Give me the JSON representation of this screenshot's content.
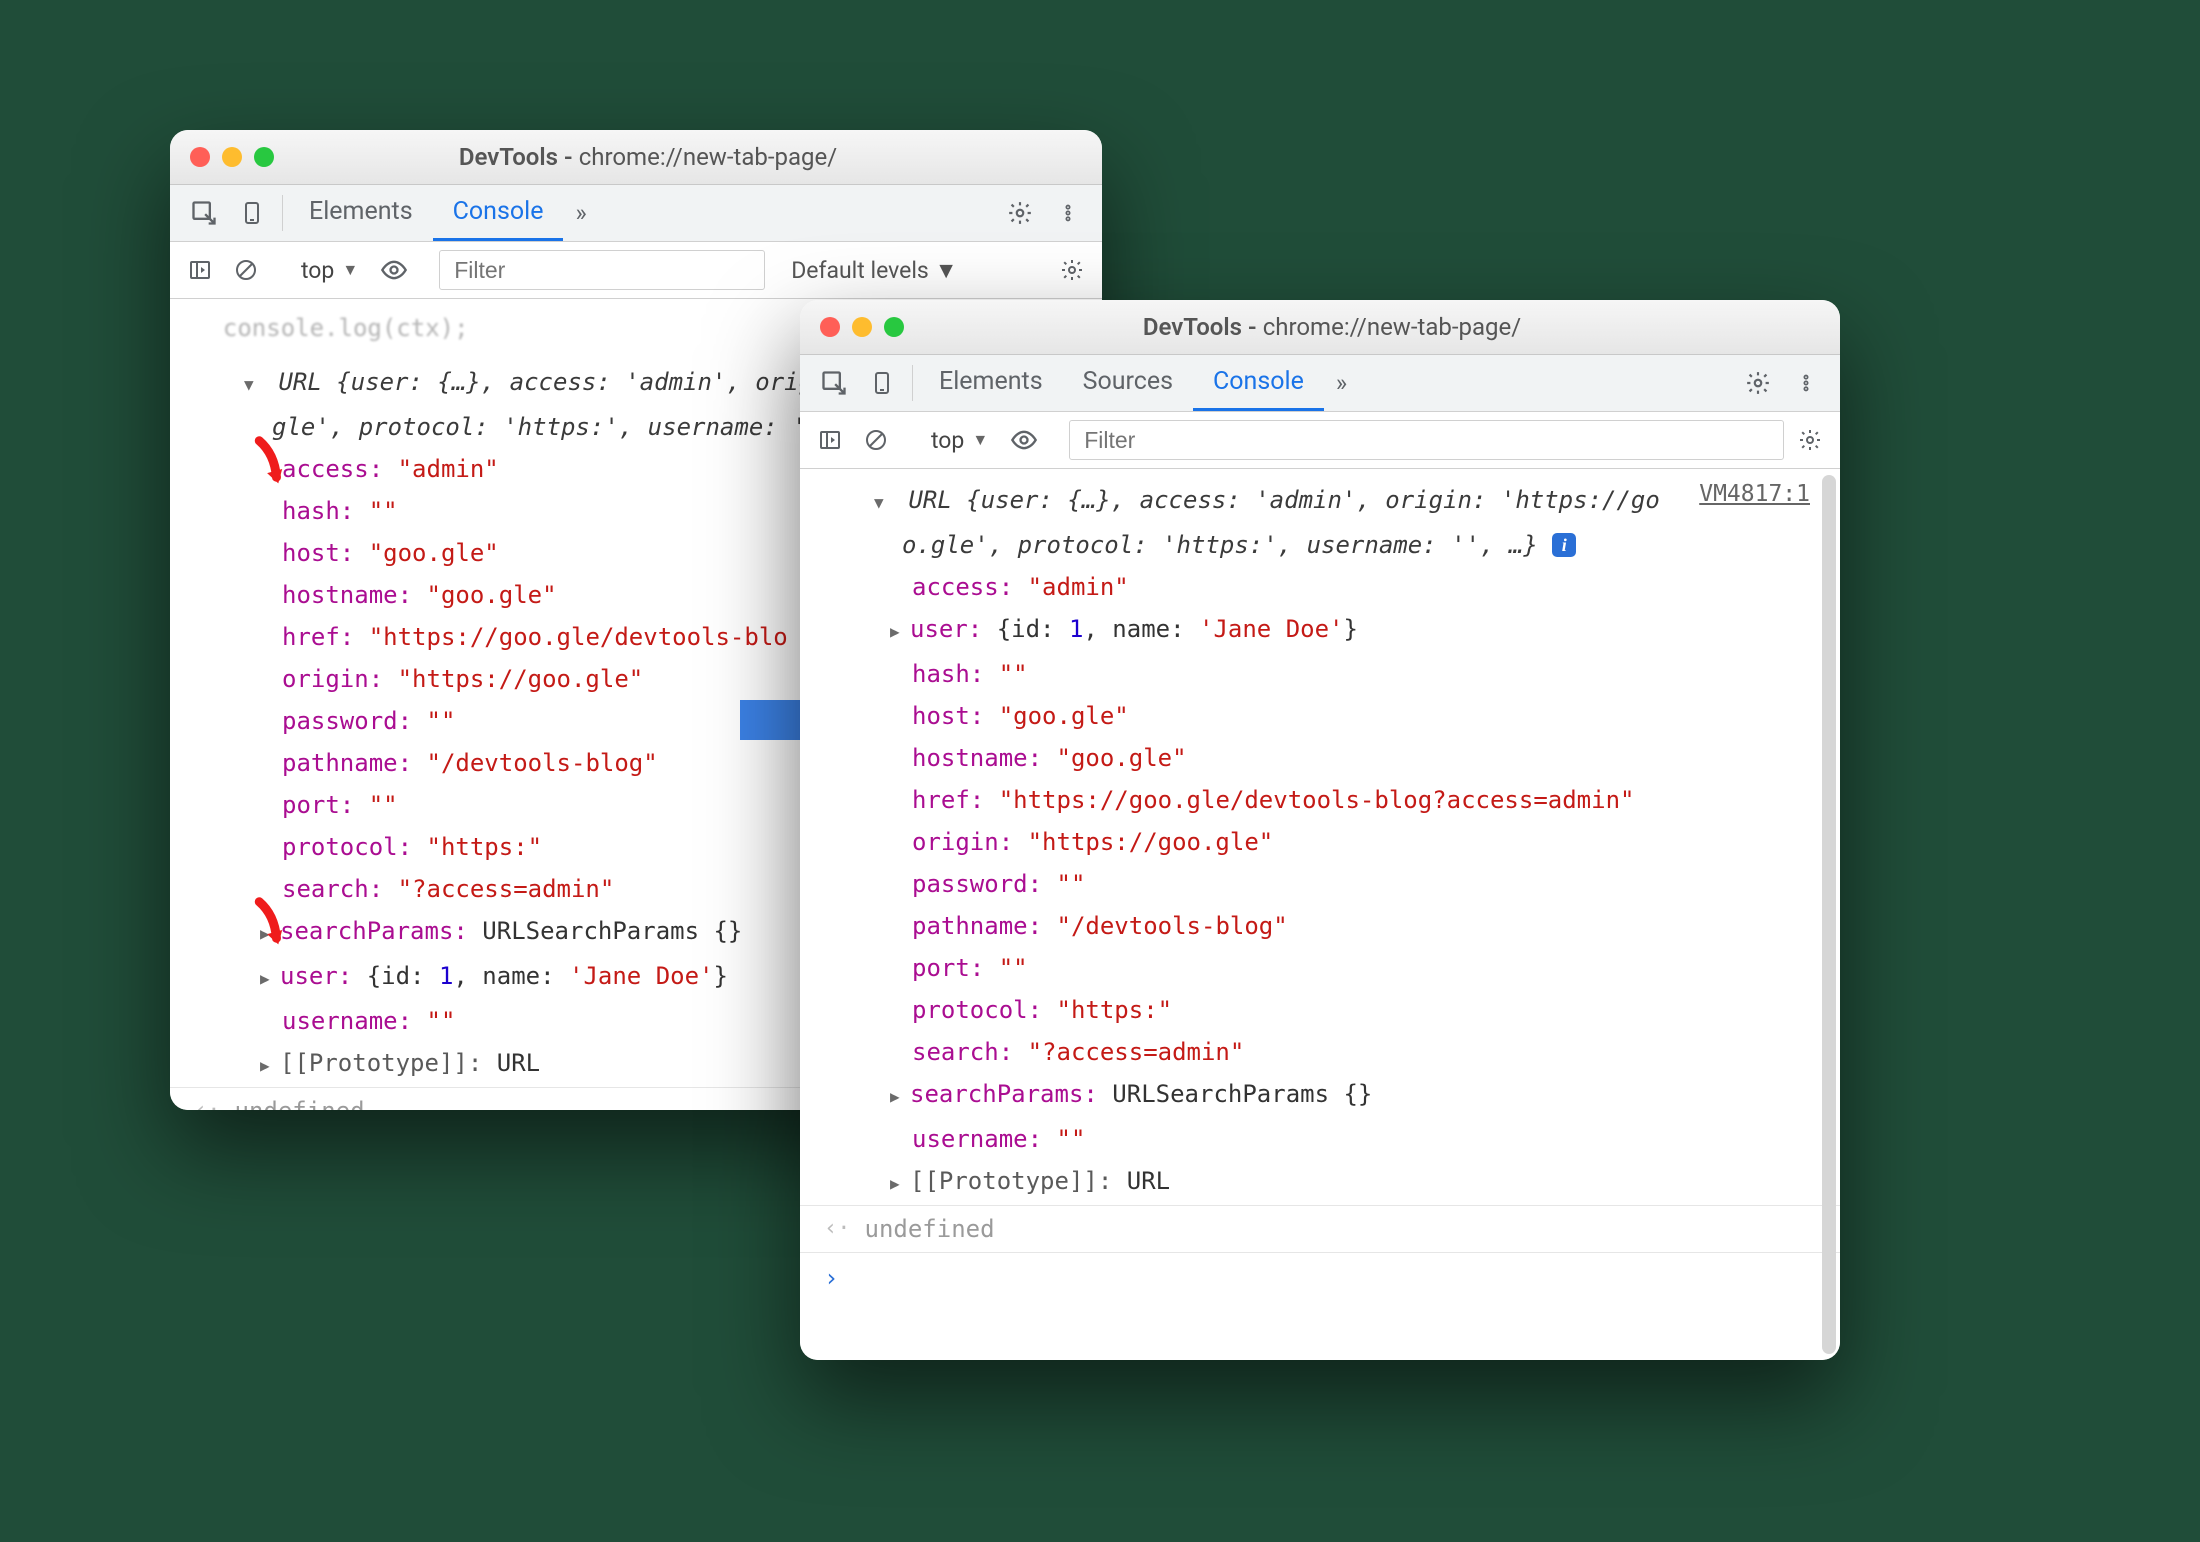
{
  "leftWindow": {
    "title_prefix": "DevTools - ",
    "title_url": "chrome://new-tab-page/",
    "tabs": {
      "elements": "Elements",
      "console": "Console"
    },
    "context": "top",
    "filter_placeholder": "Filter",
    "levels_label": "Default levels",
    "summary_line1": "URL {user: {…}, access: 'admin', orig",
    "summary_line2": "gle', protocol: 'https:', username: '",
    "props": {
      "access": {
        "k": "access: ",
        "v": "\"admin\""
      },
      "hash": {
        "k": "hash: ",
        "v": "\"\""
      },
      "host": {
        "k": "host: ",
        "v": "\"goo.gle\""
      },
      "hostname": {
        "k": "hostname: ",
        "v": "\"goo.gle\""
      },
      "href": {
        "k": "href: ",
        "v": "\"https://goo.gle/devtools-blo"
      },
      "origin": {
        "k": "origin: ",
        "v": "\"https://goo.gle\""
      },
      "password": {
        "k": "password: ",
        "v": "\"\""
      },
      "pathname": {
        "k": "pathname: ",
        "v": "\"/devtools-blog\""
      },
      "port": {
        "k": "port: ",
        "v": "\"\""
      },
      "protocol": {
        "k": "protocol: ",
        "v": "\"https:\""
      },
      "search": {
        "k": "search: ",
        "v": "\"?access=admin\""
      },
      "searchParams": {
        "k": "searchParams: ",
        "v": "URLSearchParams {}"
      },
      "user": {
        "k": "user: ",
        "pre": "{id: ",
        "id": "1",
        "mid": ", name: ",
        "name": "'Jane Doe'",
        "post": "}"
      },
      "username": {
        "k": "username: ",
        "v": "\"\""
      },
      "proto": {
        "k": "[[Prototype]]: ",
        "v": "URL"
      }
    },
    "undefined": "undefined"
  },
  "rightWindow": {
    "title_prefix": "DevTools - ",
    "title_url": "chrome://new-tab-page/",
    "tabs": {
      "elements": "Elements",
      "sources": "Sources",
      "console": "Console"
    },
    "context": "top",
    "filter_placeholder": "Filter",
    "source_link": "VM4817:1",
    "summary_line1": "URL {user: {…}, access: 'admin', origin: 'https://go",
    "summary_line2": "o.gle', protocol: 'https:', username: '', …} ",
    "props": {
      "access": {
        "k": "access: ",
        "v": "\"admin\""
      },
      "user": {
        "k": "user: ",
        "pre": "{id: ",
        "id": "1",
        "mid": ", name: ",
        "name": "'Jane Doe'",
        "post": "}"
      },
      "hash": {
        "k": "hash: ",
        "v": "\"\""
      },
      "host": {
        "k": "host: ",
        "v": "\"goo.gle\""
      },
      "hostname": {
        "k": "hostname: ",
        "v": "\"goo.gle\""
      },
      "href": {
        "k": "href: ",
        "v": "\"https://goo.gle/devtools-blog?access=admin\""
      },
      "origin": {
        "k": "origin: ",
        "v": "\"https://goo.gle\""
      },
      "password": {
        "k": "password: ",
        "v": "\"\""
      },
      "pathname": {
        "k": "pathname: ",
        "v": "\"/devtools-blog\""
      },
      "port": {
        "k": "port: ",
        "v": "\"\""
      },
      "protocol": {
        "k": "protocol: ",
        "v": "\"https:\""
      },
      "search": {
        "k": "search: ",
        "v": "\"?access=admin\""
      },
      "searchParams": {
        "k": "searchParams: ",
        "v": "URLSearchParams {}"
      },
      "username": {
        "k": "username: ",
        "v": "\"\""
      },
      "proto": {
        "k": "[[Prototype]]: ",
        "v": "URL"
      }
    },
    "undefined": "undefined"
  }
}
